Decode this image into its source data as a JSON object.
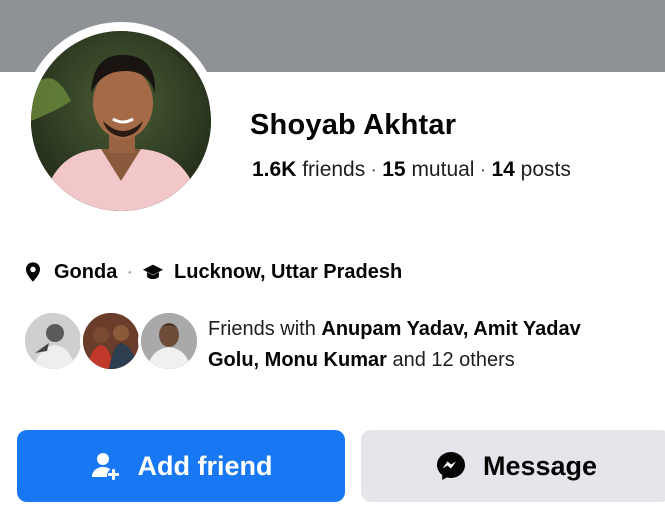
{
  "profile": {
    "name": "Shoyab Akhtar",
    "stats": {
      "friends_count": "1.6K",
      "friends_label": "friends",
      "mutual_count": "15",
      "mutual_label": "mutual",
      "posts_count": "14",
      "posts_label": "posts"
    },
    "info": {
      "location_icon": "map-pin-icon",
      "hometown": "Gonda",
      "education_icon": "graduation-cap-icon",
      "education": "Lucknow, Uttar Pradesh"
    }
  },
  "mutual_friends": {
    "prefix": "Friends with",
    "names_line1": "Anupam Yadav, Amit Yadav",
    "names_line2": "Golu, Monu Kumar",
    "suffix": "and 12 others"
  },
  "actions": {
    "add_friend_label": "Add friend",
    "add_friend_icon": "add-person-icon",
    "message_label": "Message",
    "message_icon": "messenger-icon"
  },
  "colors": {
    "primary": "#1877f2",
    "secondary_button": "#e4e6eb",
    "cover": "#8e9196"
  }
}
